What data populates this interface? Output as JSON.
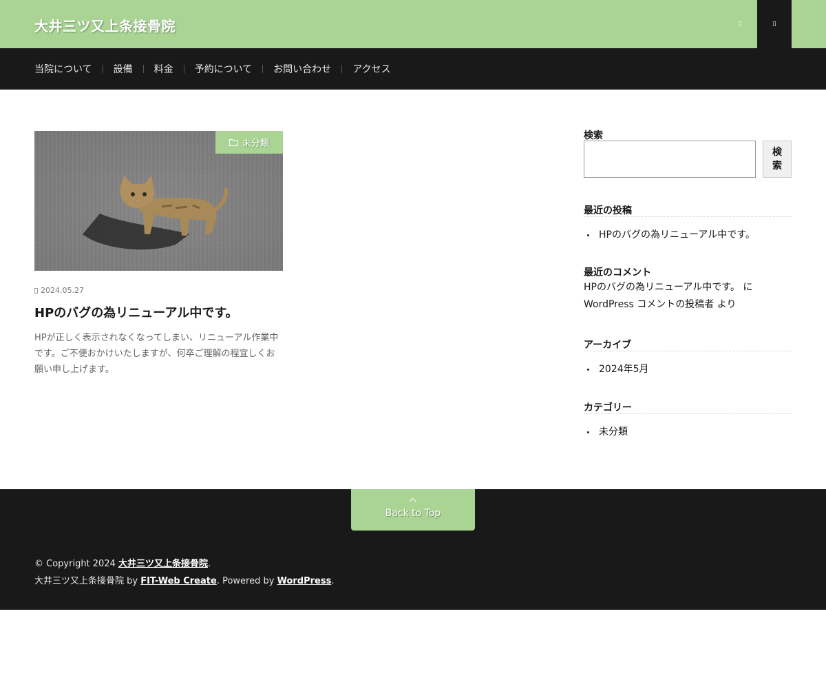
{
  "header": {
    "site_title": "大井三ツ又上条接骨院",
    "search_icon": "search-icon",
    "menu_icon": "menu-icon",
    "accent_color": "#a9d494",
    "dark_color": "#191919"
  },
  "nav": {
    "items": [
      {
        "label": "当院について"
      },
      {
        "label": "設備"
      },
      {
        "label": "料金"
      },
      {
        "label": "予約について"
      },
      {
        "label": "お問い合わせ"
      },
      {
        "label": "アクセス"
      }
    ]
  },
  "post": {
    "category": "未分類",
    "date": "2024.05.27",
    "title": "HPのバグの為リニューアル中です。",
    "excerpt": "HPが正しく表示されなくなってしまい、リニューアル作業中です。ご不便おかけいたしますが、何卒ご理解の程宜しくお願い申し上げます。",
    "thumbnail_icon": "cat-photo"
  },
  "sidebar": {
    "search": {
      "label": "検索",
      "button_label": "検索",
      "value": ""
    },
    "recent_posts": {
      "title": "最近の投稿",
      "items": [
        {
          "label": "HPのバグの為リニューアル中です。"
        }
      ]
    },
    "recent_comments": {
      "title": "最近のコメント",
      "line1": "HPのバグの為リニューアル中です。 に",
      "line2": "WordPress コメントの投稿者 より"
    },
    "archives": {
      "title": "アーカイブ",
      "items": [
        {
          "label": "2024年5月"
        }
      ]
    },
    "categories": {
      "title": "カテゴリー",
      "items": [
        {
          "label": "未分類"
        }
      ]
    }
  },
  "footer": {
    "back_to_top": "Back to Top",
    "copyright_prefix": "© Copyright 2024 ",
    "copyright_link": "大井三ツ又上条接骨院",
    "period": ".",
    "credit_prefix": "大井三ツ又上条接骨院 by ",
    "credit_link": "FIT-Web Create",
    "powered_by": ". Powered by ",
    "wp_link": "WordPress",
    "end_period": "."
  }
}
